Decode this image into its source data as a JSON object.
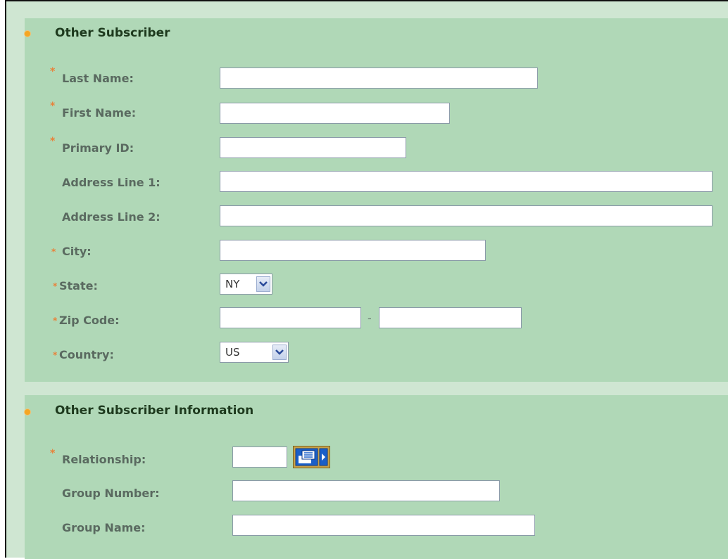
{
  "sections": {
    "subscriber": {
      "title": "Other Subscriber",
      "fields": {
        "last_name": {
          "label": "Last Name:",
          "required_mark": "*",
          "value": ""
        },
        "first_name": {
          "label": "First Name:",
          "required_mark": "*",
          "value": ""
        },
        "primary_id": {
          "label": "Primary ID:",
          "required_mark": "*",
          "value": ""
        },
        "address1": {
          "label": "Address Line 1:",
          "value": ""
        },
        "address2": {
          "label": "Address Line 2:",
          "value": ""
        },
        "city": {
          "label": "City:",
          "required_mark": "*",
          "value": ""
        },
        "state": {
          "label": "State:",
          "required_mark": "*",
          "selected": "NY"
        },
        "zip": {
          "label": "Zip Code:",
          "required_mark": "*",
          "value": "",
          "extension_value": "",
          "separator": "-"
        },
        "country": {
          "label": "Country:",
          "required_mark": "*",
          "selected": "US"
        }
      }
    },
    "subscriber_info": {
      "title": "Other Subscriber Information",
      "fields": {
        "relationship": {
          "label": "Relationship:",
          "required_mark": "*",
          "value": ""
        },
        "group_number": {
          "label": "Group Number:",
          "value": ""
        },
        "group_name": {
          "label": "Group Name:",
          "value": ""
        }
      }
    }
  },
  "icons": {
    "section_bullet": "orange-dot",
    "lookup": "list-lookup-icon",
    "dropdown": "chevron-down-icon"
  },
  "colors": {
    "frame": "#cfe6d2",
    "section_bg": "#b0d8b7",
    "required": "#e8823a",
    "bullet": "#f5a623",
    "title": "#1e3a1e",
    "label": "#5a6a60"
  }
}
